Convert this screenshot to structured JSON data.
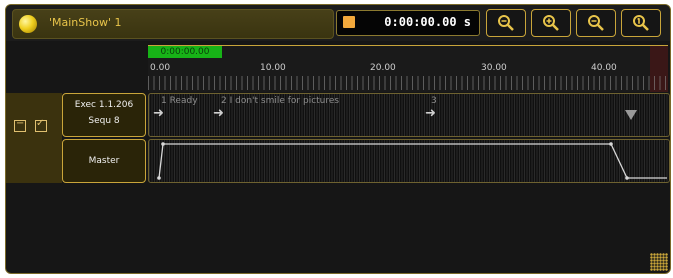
{
  "title_bar": {
    "show_title": "'MainShow' 1",
    "clock": "0:00:00.00 s",
    "zoom_buttons": [
      {
        "name": "zoom-out-icon",
        "symbol": "minus"
      },
      {
        "name": "zoom-in-icon",
        "symbol": "plus"
      },
      {
        "name": "zoom-out-icon-2",
        "symbol": "minus"
      },
      {
        "name": "zoom-fit-icon",
        "symbol": "one"
      }
    ]
  },
  "ruler": {
    "marker_time": "0:00:00.00",
    "labels": [
      "0.00",
      "10.00",
      "20.00",
      "30.00",
      "40.00"
    ]
  },
  "executor": {
    "line1": "Exec 1.1.206",
    "line2": "Sequ 8",
    "checkbox_minus": "−",
    "checkbox_check": "✓"
  },
  "master_label": "Master",
  "cues": [
    {
      "label": "1 Ready"
    },
    {
      "label": "2 I don't smile for pictures"
    },
    {
      "label": "3"
    }
  ],
  "colors": {
    "accent_border": "#c9a53a",
    "marker_green": "#17b317",
    "clock_square": "#f3a93c"
  }
}
